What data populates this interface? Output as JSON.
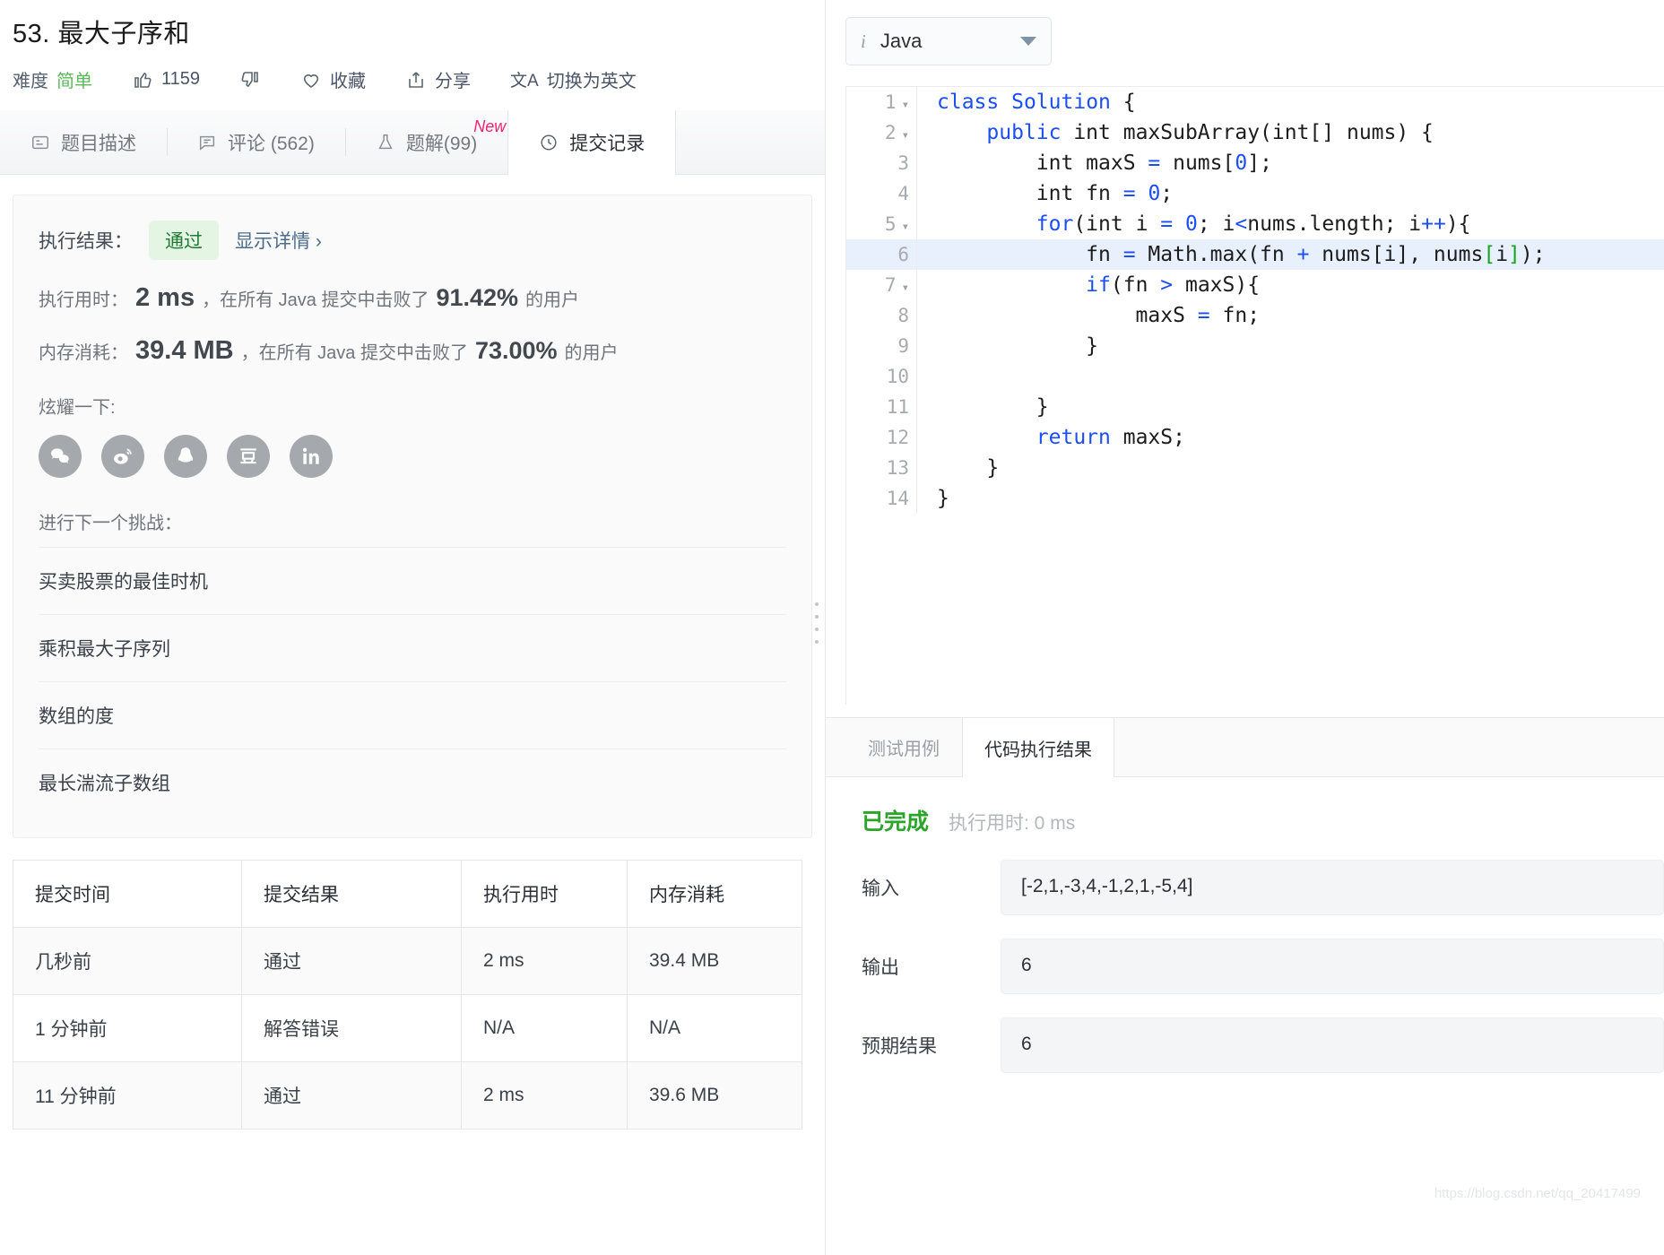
{
  "problem": {
    "title": "53. 最大子序和",
    "difficulty_label": "难度",
    "difficulty_value": "简单",
    "likes": "1159",
    "favorite_label": "收藏",
    "share_label": "分享",
    "translate_label": "切换为英文",
    "translate_icon_text": "文A"
  },
  "tabs": [
    {
      "label": "题目描述",
      "icon": "description-icon",
      "active": false,
      "badge": ""
    },
    {
      "label": "评论 (562)",
      "icon": "comment-icon",
      "active": false,
      "badge": ""
    },
    {
      "label": "题解(99)",
      "icon": "flask-icon",
      "active": false,
      "badge": "New"
    },
    {
      "label": "提交记录",
      "icon": "clock-icon",
      "active": true,
      "badge": ""
    }
  ],
  "result": {
    "exec_result_label": "执行结果：",
    "status_badge": "通过",
    "detail_link": "显示详情 ›",
    "runtime": {
      "label": "执行用时：",
      "value": "2 ms",
      "mid": "，在所有 Java 提交中击败了",
      "percent": "91.42%",
      "suffix": "的用户"
    },
    "memory": {
      "label": "内存消耗：",
      "value": "39.4 MB",
      "mid": "，在所有 Java 提交中击败了",
      "percent": "73.00%",
      "suffix": "的用户"
    },
    "share_label": "炫耀一下:",
    "share_icons": [
      "wechat-icon",
      "weibo-icon",
      "qq-icon",
      "douban-icon",
      "linkedin-icon"
    ],
    "next_label": "进行下一个挑战：",
    "challenges": [
      "买卖股票的最佳时机",
      "乘积最大子序列",
      "数组的度",
      "最长湍流子数组"
    ]
  },
  "submissions": {
    "headers": [
      "提交时间",
      "提交结果",
      "执行用时",
      "内存消耗"
    ],
    "rows": [
      {
        "time": "几秒前",
        "status": "通过",
        "status_type": "pass",
        "runtime": "2 ms",
        "memory": "39.4 MB"
      },
      {
        "time": "1 分钟前",
        "status": "解答错误",
        "status_type": "fail",
        "runtime": "N/A",
        "memory": "N/A"
      },
      {
        "time": "11 分钟前",
        "status": "通过",
        "status_type": "pass",
        "runtime": "2 ms",
        "memory": "39.6 MB"
      }
    ]
  },
  "editor": {
    "language": "Java",
    "lines": [
      {
        "n": "1",
        "fold": true,
        "highlight": false,
        "text": "class Solution {"
      },
      {
        "n": "2",
        "fold": true,
        "highlight": false,
        "text": "    public int maxSubArray(int[] nums) {"
      },
      {
        "n": "3",
        "fold": false,
        "highlight": false,
        "text": "        int maxS = nums[0];"
      },
      {
        "n": "4",
        "fold": false,
        "highlight": false,
        "text": "        int fn = 0;"
      },
      {
        "n": "5",
        "fold": true,
        "highlight": false,
        "text": "        for(int i = 0; i<nums.length; i++){"
      },
      {
        "n": "6",
        "fold": false,
        "highlight": true,
        "text": "            fn = Math.max(fn + nums[i], nums[i]);"
      },
      {
        "n": "7",
        "fold": true,
        "highlight": false,
        "text": "            if(fn > maxS){"
      },
      {
        "n": "8",
        "fold": false,
        "highlight": false,
        "text": "                maxS = fn;"
      },
      {
        "n": "9",
        "fold": false,
        "highlight": false,
        "text": "            }"
      },
      {
        "n": "10",
        "fold": false,
        "highlight": false,
        "text": ""
      },
      {
        "n": "11",
        "fold": false,
        "highlight": false,
        "text": "        }"
      },
      {
        "n": "12",
        "fold": false,
        "highlight": false,
        "text": "        return maxS;"
      },
      {
        "n": "13",
        "fold": false,
        "highlight": false,
        "text": "    }"
      },
      {
        "n": "14",
        "fold": false,
        "highlight": false,
        "text": "}"
      }
    ]
  },
  "console": {
    "tabs": [
      {
        "label": "测试用例",
        "active": false
      },
      {
        "label": "代码执行结果",
        "active": true
      }
    ],
    "status": "已完成",
    "status_time": "执行用时: 0 ms",
    "fields": [
      {
        "key": "输入",
        "value": "[-2,1,-3,4,-1,2,1,-5,4]"
      },
      {
        "key": "输出",
        "value": "6"
      },
      {
        "key": "预期结果",
        "value": "6"
      }
    ],
    "watermark": "https://blog.csdn.net/qq_20417499"
  },
  "colors": {
    "easy": "#5cb85c",
    "pass_badge_bg": "#e4f5e4",
    "pass_badge_text": "#1e7a34",
    "pass_text": "#12b886",
    "fail_text": "#d93025",
    "new_badge": "#f0256d",
    "keyword": "#1b4ef5",
    "bracket_match": "#16a422",
    "line_highlight": "#e8f0fd"
  }
}
